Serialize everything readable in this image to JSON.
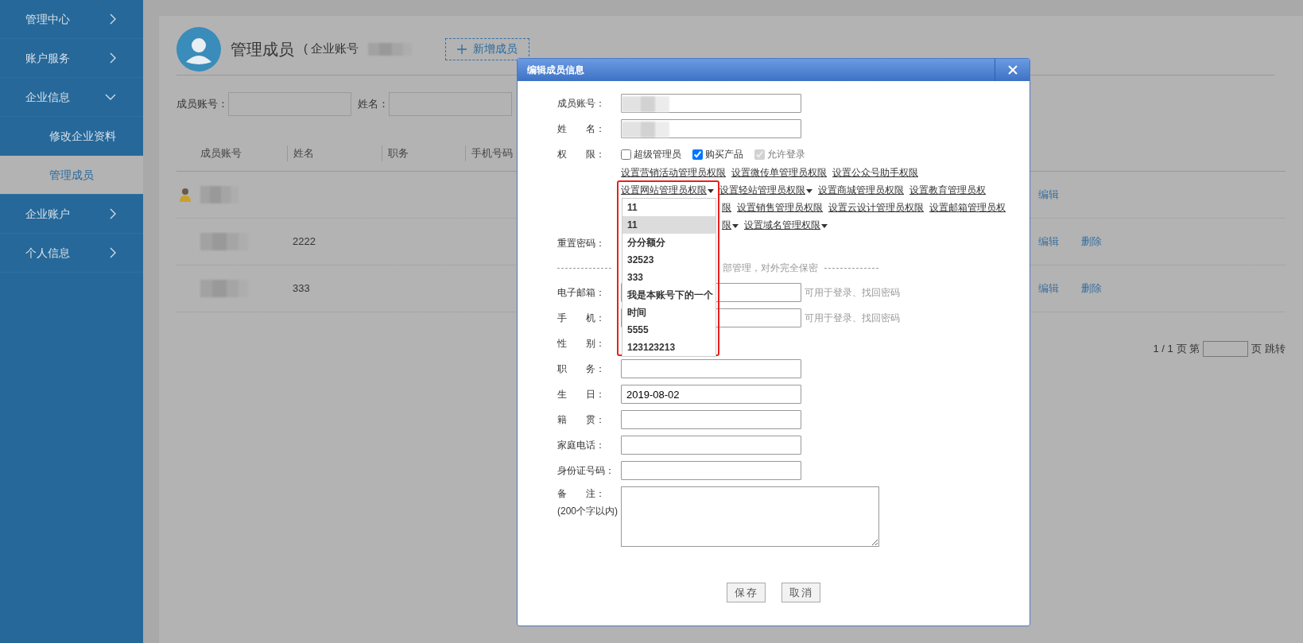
{
  "sidebar": {
    "items": [
      {
        "label": "管理中心",
        "selected": false,
        "expanded": false
      },
      {
        "label": "账户服务",
        "selected": false,
        "expanded": false
      },
      {
        "label": "企业信息",
        "selected": false,
        "expanded": true,
        "children": [
          {
            "label": "修改企业资料",
            "selected": false
          },
          {
            "label": "管理成员",
            "selected": true
          }
        ]
      },
      {
        "label": "企业账户",
        "selected": false,
        "expanded": false
      },
      {
        "label": "个人信息",
        "selected": false,
        "expanded": false
      }
    ]
  },
  "header": {
    "title": "管理成员",
    "account_label": "( 企业账号",
    "account_blurred": true,
    "add_button": "新增成员"
  },
  "filters": [
    {
      "label": "成员账号："
    },
    {
      "label": "姓名："
    }
  ],
  "table": {
    "columns": [
      "成员账号",
      "姓名",
      "职务",
      "手机号码"
    ],
    "rows": [
      {
        "owner": true,
        "account_blurred": true,
        "actions": [
          "编辑"
        ]
      },
      {
        "owner": false,
        "account_blurred": true,
        "name": "2222",
        "actions": [
          "编辑",
          "删除"
        ]
      },
      {
        "owner": false,
        "account_blurred": true,
        "name": "333",
        "actions": [
          "编辑",
          "删除"
        ]
      }
    ]
  },
  "pagination": {
    "status": "1 / 1",
    "go_prefix": "页 第",
    "go_suffix": "页 跳转"
  },
  "dialog": {
    "title": "编辑成员信息",
    "fields": [
      {
        "kind": "input",
        "label": "成员账号：",
        "blurred": true
      },
      {
        "kind": "input",
        "label": "姓　　名：",
        "blurred": true
      },
      {
        "kind": "permissions",
        "label": "权　　限：",
        "options": [
          {
            "label": "超级管理员",
            "checked": false,
            "disabled": false
          },
          {
            "label": "购买产品",
            "checked": true,
            "disabled": false
          },
          {
            "label": "允许登录",
            "checked": true,
            "disabled": true
          }
        ],
        "link_rows": [
          {
            "partly_covered": false,
            "links": [
              {
                "label": "设置营销活动管理员权限",
                "has_menu": false
              },
              {
                "label": "设置微传单管理员权限",
                "has_menu": false
              },
              {
                "label": "设置公众号助手权限",
                "has_menu": false
              }
            ]
          },
          {
            "partly_covered": false,
            "links": [
              {
                "label": "设置网站管理员权限",
                "has_menu": true
              },
              {
                "label": "设置轻站管理员权限",
                "has_menu": true
              },
              {
                "label": "设置商城管理员权限",
                "has_menu": false
              },
              {
                "label": "设置教育管理员权",
                "has_menu": false
              }
            ]
          },
          {
            "partly_covered": true,
            "links": [
              {
                "label": "限",
                "has_menu": false
              },
              {
                "label": "设置销售管理员权限",
                "has_menu": false
              },
              {
                "label": "设置云设计管理员权限",
                "has_menu": false
              },
              {
                "label": "设置邮箱管理员权",
                "has_menu": false
              }
            ]
          },
          {
            "partly_covered": true,
            "links": [
              {
                "label": "限",
                "has_menu": true
              },
              {
                "label": "设置域名管理权限",
                "has_menu": true
              }
            ]
          }
        ]
      },
      {
        "kind": "covered",
        "label": "重置密码："
      },
      {
        "kind": "note",
        "text": "部管理，对外完全保密"
      },
      {
        "kind": "input",
        "label": "电子邮箱：",
        "help_text": "可用于登录、找回密码"
      },
      {
        "kind": "input",
        "label": "手　　机：",
        "help_text": "可用于登录、找回密码"
      },
      {
        "kind": "covered",
        "label": "性　　别："
      },
      {
        "kind": "input",
        "label": "职　　务："
      },
      {
        "kind": "input",
        "label": "生　　日：",
        "value": "2019-08-02"
      },
      {
        "kind": "input",
        "label": "籍　　贯："
      },
      {
        "kind": "input",
        "label": "家庭电话："
      },
      {
        "kind": "input",
        "label": "身份证号码："
      },
      {
        "kind": "textarea",
        "label": "备　　注：",
        "sublabel": "(200个字以内)"
      }
    ],
    "dropdown": {
      "items": [
        {
          "label": "11",
          "selected": false
        },
        {
          "label": "11",
          "selected": true
        },
        {
          "label": "分分额分",
          "selected": false
        },
        {
          "label": "32523",
          "selected": false
        },
        {
          "label": "333",
          "selected": false
        },
        {
          "label": "我是本账号下的一个",
          "selected": false
        },
        {
          "label": "时间",
          "selected": false
        },
        {
          "label": "5555",
          "selected": false
        },
        {
          "label": "123123213",
          "selected": false
        }
      ]
    },
    "buttons": [
      "保存",
      "取消"
    ]
  }
}
